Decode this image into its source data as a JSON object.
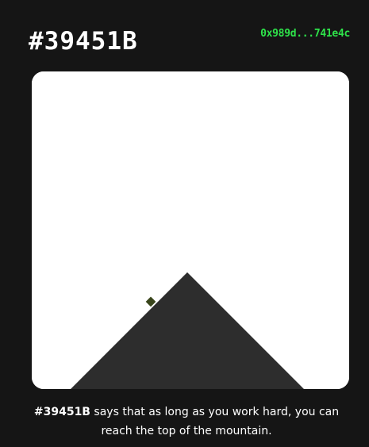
{
  "header": {
    "title": "#39451B",
    "wallet_address": "0x989d...741e4c"
  },
  "artwork": {
    "name": "mountain-artwork",
    "background_color": "#ffffff",
    "mountain_color": "#2d2d2d",
    "climber_color": "#39451b"
  },
  "caption": {
    "highlight": "#39451B",
    "text": " says that as long as you work hard, you can reach the top of the mountain."
  },
  "colors": {
    "page_background": "#151515",
    "accent": "#2ee34a"
  }
}
